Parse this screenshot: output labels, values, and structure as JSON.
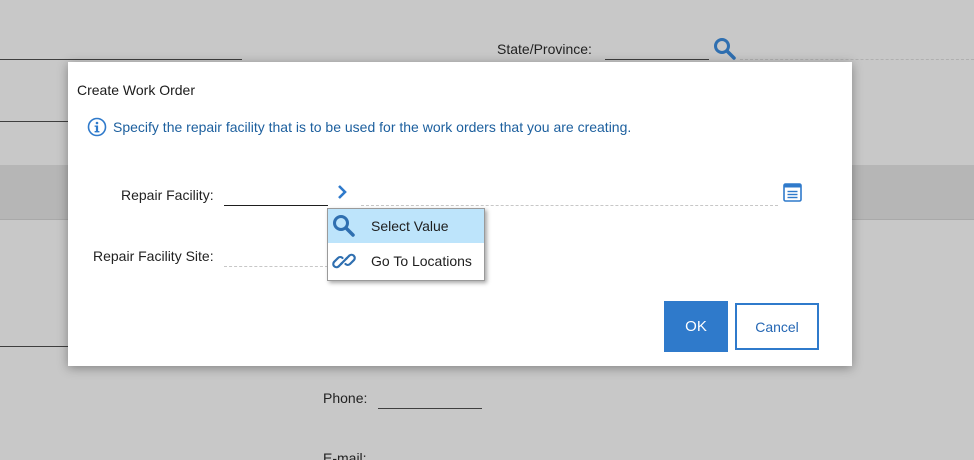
{
  "background": {
    "state_label": "State/Province:",
    "phone_label": "Phone:",
    "email_label": "E-mail:"
  },
  "dialog": {
    "title": "Create Work Order",
    "info_text": "Specify the repair facility that is to be used for the work orders that you are creating.",
    "repair_facility_label": "Repair Facility:",
    "repair_facility_value": "",
    "repair_facility_site_label": "Repair Facility Site:",
    "repair_facility_site_value": "",
    "ok_label": "OK",
    "cancel_label": "Cancel"
  },
  "menu": {
    "items": [
      {
        "label": "Select Value",
        "icon": "search-icon",
        "active": true
      },
      {
        "label": "Go To Locations",
        "icon": "link-icon",
        "active": false
      }
    ]
  },
  "colors": {
    "accent": "#2f7acb",
    "info_text": "#1c5f9e",
    "menu_highlight": "#bde4fb",
    "overlay": "#c8c8c8"
  }
}
